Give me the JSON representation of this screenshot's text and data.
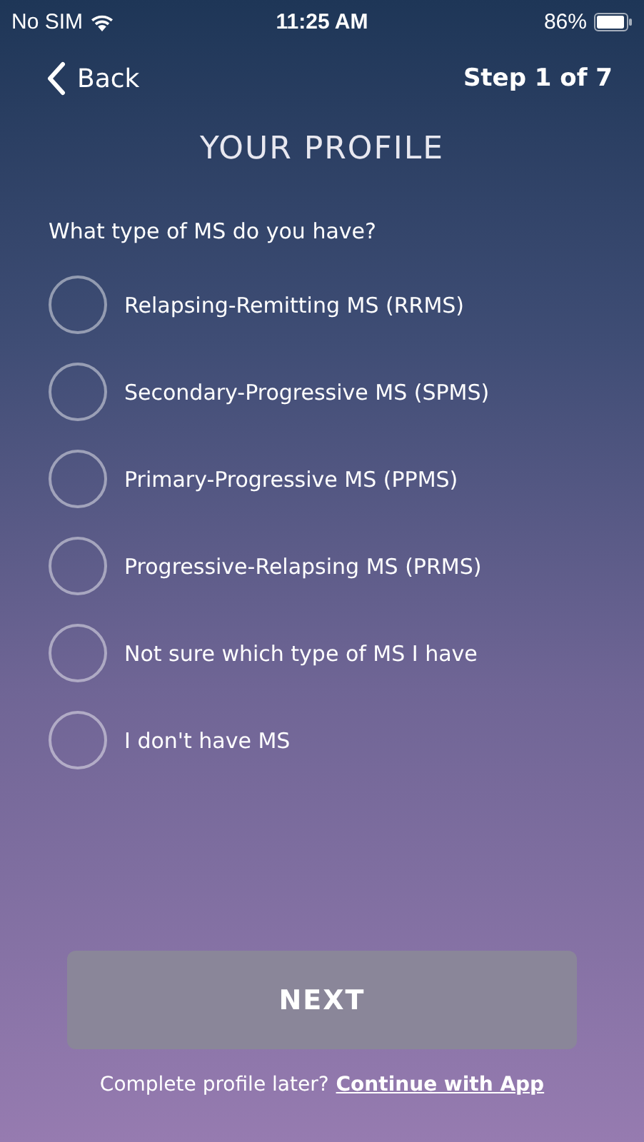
{
  "status_bar": {
    "carrier": "No SIM",
    "time": "11:25 AM",
    "battery": "86%"
  },
  "nav": {
    "back": "Back",
    "step": "Step 1 of 7"
  },
  "title": "YOUR PROFILE",
  "question": "What type of MS do you have?",
  "options": [
    {
      "label": "Relapsing-Remitting MS (RRMS)",
      "selected": false
    },
    {
      "label": "Secondary-Progressive MS (SPMS)",
      "selected": false
    },
    {
      "label": "Primary-Progressive MS (PPMS)",
      "selected": false
    },
    {
      "label": "Progressive-Relapsing MS (PRMS)",
      "selected": false
    },
    {
      "label": "Not sure which type of MS I have",
      "selected": false
    },
    {
      "label": "I don't have MS",
      "selected": false
    }
  ],
  "next_button": {
    "label": "NEXT",
    "disabled": true
  },
  "footer": {
    "text": "Complete profile later?",
    "link": "Continue with App"
  }
}
